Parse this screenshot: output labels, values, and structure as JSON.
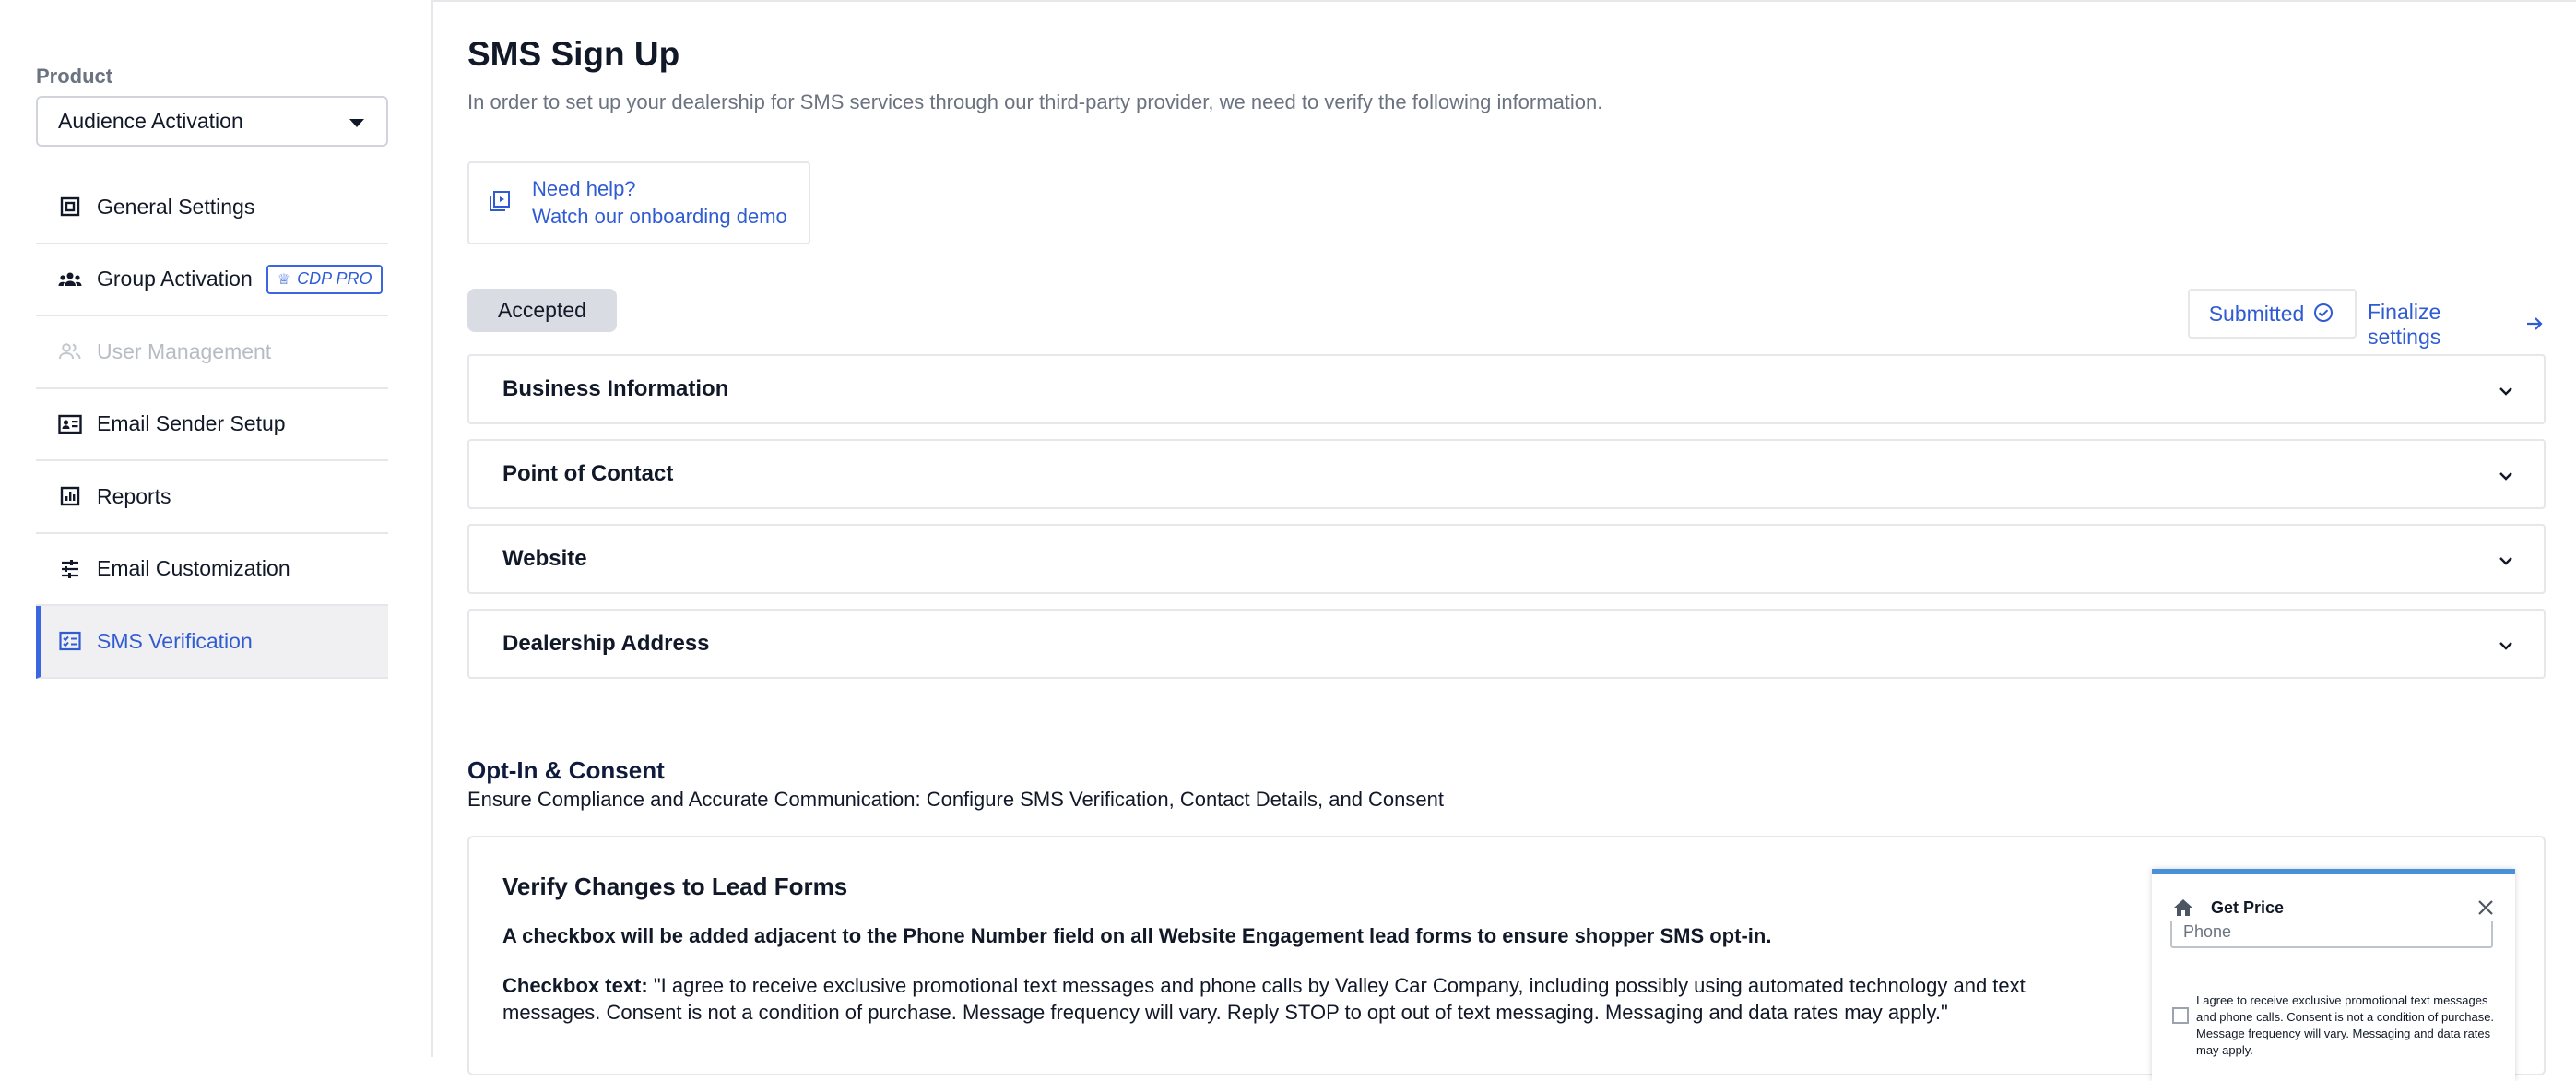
{
  "sidebar": {
    "product_label": "Product",
    "product_value": "Audience Activation",
    "items": [
      {
        "label": "General Settings",
        "icon": "settings-square-icon"
      },
      {
        "label": "Group Activation",
        "icon": "group-icon",
        "badge": "CDP PRO"
      },
      {
        "label": "User Management",
        "icon": "users-icon"
      },
      {
        "label": "Email Sender Setup",
        "icon": "id-card-icon"
      },
      {
        "label": "Reports",
        "icon": "bar-report-icon"
      },
      {
        "label": "Email Customization",
        "icon": "sliders-icon"
      },
      {
        "label": "SMS Verification",
        "icon": "sms-check-icon"
      }
    ]
  },
  "main": {
    "title": "SMS Sign Up",
    "subtitle": "In order to set up your dealership for SMS services through our third-party provider, we need to verify the following information.",
    "help": {
      "line1": "Need help?",
      "line2": "Watch our onboarding demo"
    },
    "status": "Accepted",
    "submitted_label": "Submitted",
    "finalize_label": "Finalize settings",
    "accordions": [
      "Business Information",
      "Point of Contact",
      "Website",
      "Dealership Address"
    ],
    "optin": {
      "title": "Opt-In & Consent",
      "subtitle": "Ensure Compliance and Accurate Communication: Configure SMS Verification, Contact Details, and Consent"
    },
    "card": {
      "title": "Verify Changes to Lead Forms",
      "note": "A checkbox will be added adjacent to the Phone Number field on all Website Engagement lead forms to ensure shopper SMS opt-in.",
      "checkbox_label": "Checkbox text:",
      "checkbox_text": " \"I agree to receive exclusive promotional text messages and phone calls by Valley Car Company, including possibly using automated technology and text messages. Consent is not a condition of purchase. Message frequency will vary. Reply STOP to opt out of text messaging. Messaging and data rates may apply.\""
    },
    "preview": {
      "title": "Get Price",
      "phone_placeholder": "Phone",
      "consent": "I agree to receive exclusive promotional text messages and phone calls. Consent is not a condition of purchase. Message frequency will vary. Messaging and data rates may apply."
    }
  },
  "colors": {
    "accent": "#2f5bd3",
    "active_bar": "#3b66e0",
    "preview_bar": "#4a90d9"
  }
}
